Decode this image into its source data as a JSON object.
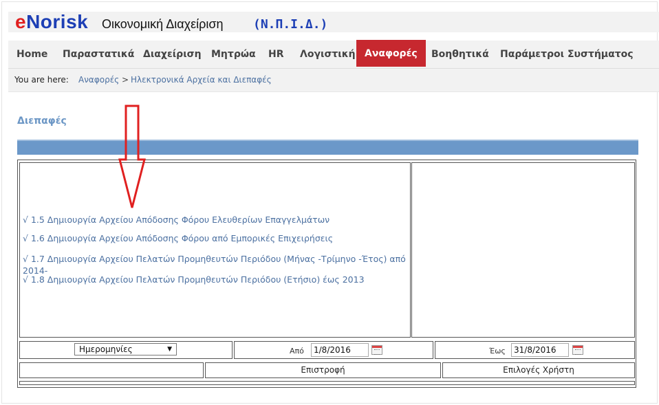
{
  "brand": {
    "logo_e": "e",
    "logo_rest": "Norisk",
    "title": "Οικονομική Διαχείριση",
    "org": "(Ν.Π.Ι.Δ.)"
  },
  "nav": {
    "items": [
      {
        "label": "Home"
      },
      {
        "label": "Παραστατικά"
      },
      {
        "label": "Διαχείριση"
      },
      {
        "label": "Μητρώα"
      },
      {
        "label": "HR"
      },
      {
        "label": "Λογιστική"
      },
      {
        "label": "Αναφορές"
      },
      {
        "label": "Βοηθητικά"
      },
      {
        "label": "Παράμετροι Συστήματος"
      }
    ],
    "active": "Αναφορές",
    "active_color": "#c7282f"
  },
  "breadcrumb": {
    "label": "You are here:",
    "parent": "Αναφορές",
    "separator": ">",
    "current": "Ηλεκτρονικά Αρχεία και Διεπαφές"
  },
  "section": {
    "title": "Διεπαφές"
  },
  "links": [
    {
      "text": "√ 1.5 Δημιουργία Αρχείου Απόδοσης Φόρου Ελευθερίων Επαγγελμάτων"
    },
    {
      "text": "√ 1.6 Δημιουργία Αρχείου Απόδοσης Φόρου από Εμπορικές Επιχειρήσεις"
    },
    {
      "text": "√ 1.7 Δημιουργία Αρχείου Πελατών Προμηθευτών Περιόδου (Μήνας -Τρίμηνο -Έτος) από"
    },
    {
      "text": "2014-"
    },
    {
      "text": "√ 1.8 Δημιουργία Αρχείου Πελατών Προμηθευτών Περιόδου (Ετήσιο) έως 2013"
    }
  ],
  "filters": {
    "period_select": "Ημερομηνίες",
    "from_label": "Από",
    "from_value": "1/8/2016",
    "to_label": "Έως",
    "to_value": "31/8/2016"
  },
  "actions": {
    "back": "Επιστροφή",
    "user_options": "Επιλογές Χρήστη"
  },
  "colors": {
    "section_title": "#6b96c5",
    "bar": "#6b98c9",
    "link": "#4a6fa0",
    "arrow": "#e02020"
  }
}
